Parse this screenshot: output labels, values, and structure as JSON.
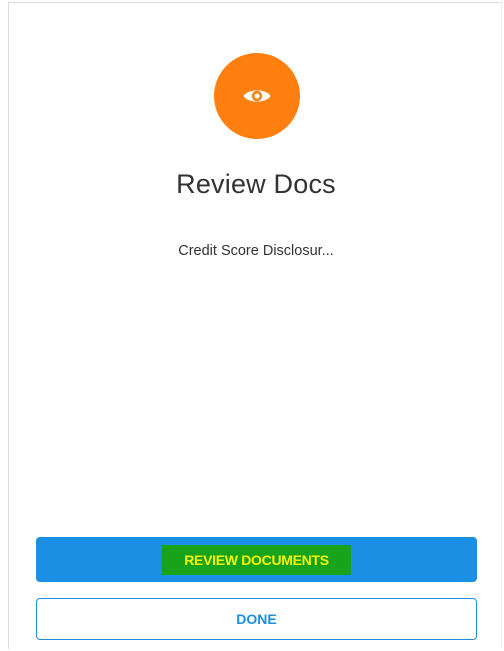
{
  "header": {
    "icon": "eye-icon",
    "title": "Review Docs"
  },
  "documents": [
    {
      "name": "Credit Score Disclosur..."
    }
  ],
  "actions": {
    "review_label": "REVIEW DOCUMENTS",
    "done_label": "DONE"
  },
  "colors": {
    "icon_circle": "#ff8010",
    "primary": "#1a8fe3",
    "highlight_bg": "#17a31a",
    "highlight_text": "#f5f500"
  }
}
